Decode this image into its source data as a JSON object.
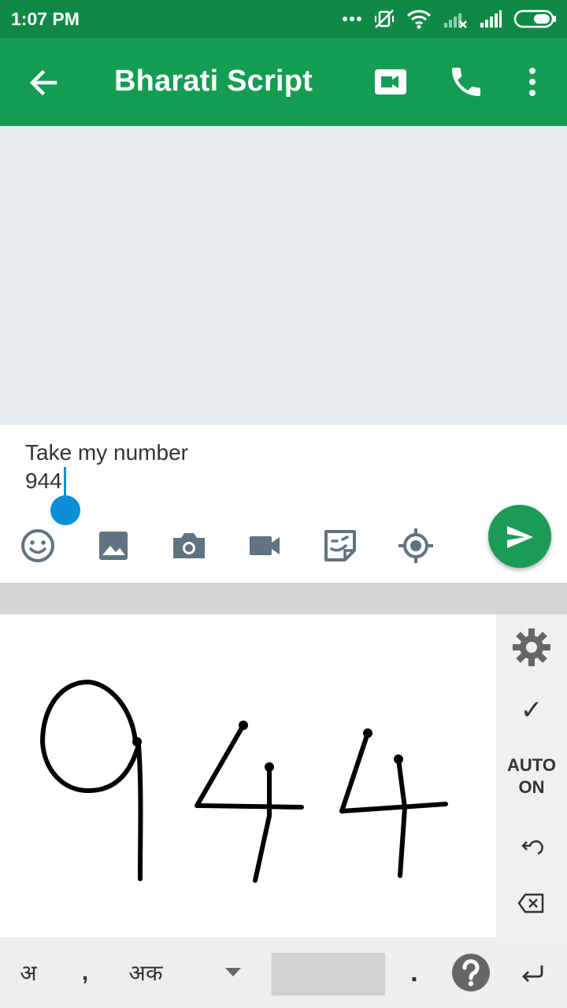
{
  "status_bar": {
    "time": "1:07 PM",
    "icons": [
      "more-dots-icon",
      "vibrate-off-icon",
      "wifi-icon",
      "signal-no-service-icon",
      "signal-icon",
      "battery-icon"
    ]
  },
  "app_bar": {
    "title": "Bharati Script",
    "icons": [
      "back-arrow-icon",
      "video-call-icon",
      "phone-icon",
      "more-vert-icon"
    ]
  },
  "compose": {
    "message_text": "Take my number\n944",
    "attachments": [
      "emoji-icon",
      "image-icon",
      "camera-icon",
      "video-icon",
      "sticker-icon",
      "location-icon"
    ],
    "send_icon": "send-icon"
  },
  "handwriting": {
    "drawn_text": "944",
    "side_controls": {
      "settings_icon": "gear-icon",
      "confirm_label": "✓",
      "auto_label_line1": "AUTO",
      "auto_label_line2": "ON",
      "undo_icon": "undo-icon",
      "backspace_icon": "backspace-icon"
    }
  },
  "bottom_bar": {
    "lang_key": "अ",
    "comma_key": ",",
    "aka_key": "अक",
    "dropdown_icon": "triangle-down-icon",
    "period_key": ".",
    "help_icon": "help-icon",
    "enter_icon": "enter-icon"
  },
  "colors": {
    "status_bar": "#0f8a46",
    "app_bar": "#149d52",
    "send_button": "#1a9b57",
    "cursor": "#0a8fd8",
    "attach_icons": "#5f7381"
  }
}
